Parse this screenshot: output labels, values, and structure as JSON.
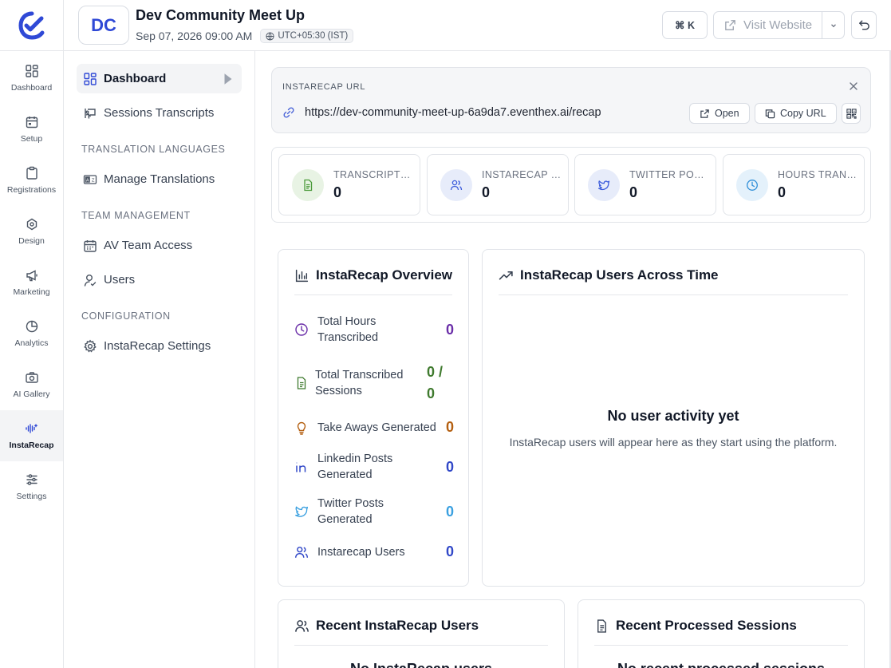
{
  "rail": {
    "items": [
      {
        "label": "Dashboard",
        "icon": "grid-icon"
      },
      {
        "label": "Setup",
        "icon": "calendar-icon"
      },
      {
        "label": "Registrations",
        "icon": "clipboard-icon"
      },
      {
        "label": "Design",
        "icon": "palette-icon"
      },
      {
        "label": "Marketing",
        "icon": "megaphone-icon"
      },
      {
        "label": "Analytics",
        "icon": "pie-chart-icon"
      },
      {
        "label": "AI Gallery",
        "icon": "camera-icon"
      },
      {
        "label": "InstaRecap",
        "icon": "audio-wave-icon",
        "active": true
      },
      {
        "label": "Settings",
        "icon": "sliders-icon"
      }
    ]
  },
  "sidebar": {
    "dashboard": "Dashboard",
    "sessions_transcripts": "Sessions Transcripts",
    "translation_heading": "Translation Languages",
    "manage_translations": "Manage Translations",
    "team_heading": "Team Management",
    "av_team_access": "AV Team Access",
    "users": "Users",
    "config_heading": "Configuration",
    "instarecap_settings": "InstaRecap Settings"
  },
  "header": {
    "logo_text": "DC",
    "event_title": "Dev Community Meet Up",
    "event_date": "Sep 07, 2026 09:00 AM",
    "timezone": "UTC+05:30 (IST)",
    "shortcut": "⌘ K",
    "visit_website": "Visit Website"
  },
  "url_card": {
    "label": "InstaRecap URL",
    "url": "https://dev-community-meet-up-6a9da7.eventhex.ai/recap",
    "open_label": "Open",
    "copy_label": "Copy URL"
  },
  "stats": [
    {
      "label": "TRANSCRIPT…",
      "value": "0",
      "icon": "file-text-icon",
      "color": "#4a9a3a",
      "bg": "#e8f3e4"
    },
    {
      "label": "INSTARECAP …",
      "value": "0",
      "icon": "users-icon",
      "color": "#3b5bdb",
      "bg": "#e7ecfa"
    },
    {
      "label": "TWITTER PO…",
      "value": "0",
      "icon": "twitter-icon",
      "color": "#3b5bdb",
      "bg": "#e7ecfa"
    },
    {
      "label": "HOURS TRAN…",
      "value": "0",
      "icon": "clock-icon",
      "color": "#2f8fd8",
      "bg": "#e4f1fb"
    }
  ],
  "overview": {
    "title": "InstaRecap Overview",
    "rows": [
      {
        "label": "Total Hours Transcribed",
        "value": "0",
        "color": "#6a2ea8"
      },
      {
        "label": "Total Transcribed Sessions",
        "value": "0 / 0",
        "color": "#3f7a2e"
      },
      {
        "label": "Take Aways Generated",
        "value": "0",
        "color": "#b45f10"
      },
      {
        "label": "Linkedin Posts Generated",
        "value": "0",
        "color": "#3148c8"
      },
      {
        "label": "Twitter Posts Generated",
        "value": "0",
        "color": "#3aa0e0"
      },
      {
        "label": "Instarecap Users",
        "value": "0",
        "color": "#3148c8"
      }
    ]
  },
  "users_time": {
    "title": "InstaRecap Users Across Time",
    "empty_title": "No user activity yet",
    "empty_sub": "InstaRecap users will appear here as they start using the platform."
  },
  "recent_users": {
    "title": "Recent InstaRecap Users",
    "empty_title": "No InstaRecap users"
  },
  "recent_sessions": {
    "title": "Recent Processed Sessions",
    "empty_title": "No recent processed sessions"
  },
  "colors": {
    "brand": "#2f49d6",
    "border": "#e1e4e9"
  }
}
